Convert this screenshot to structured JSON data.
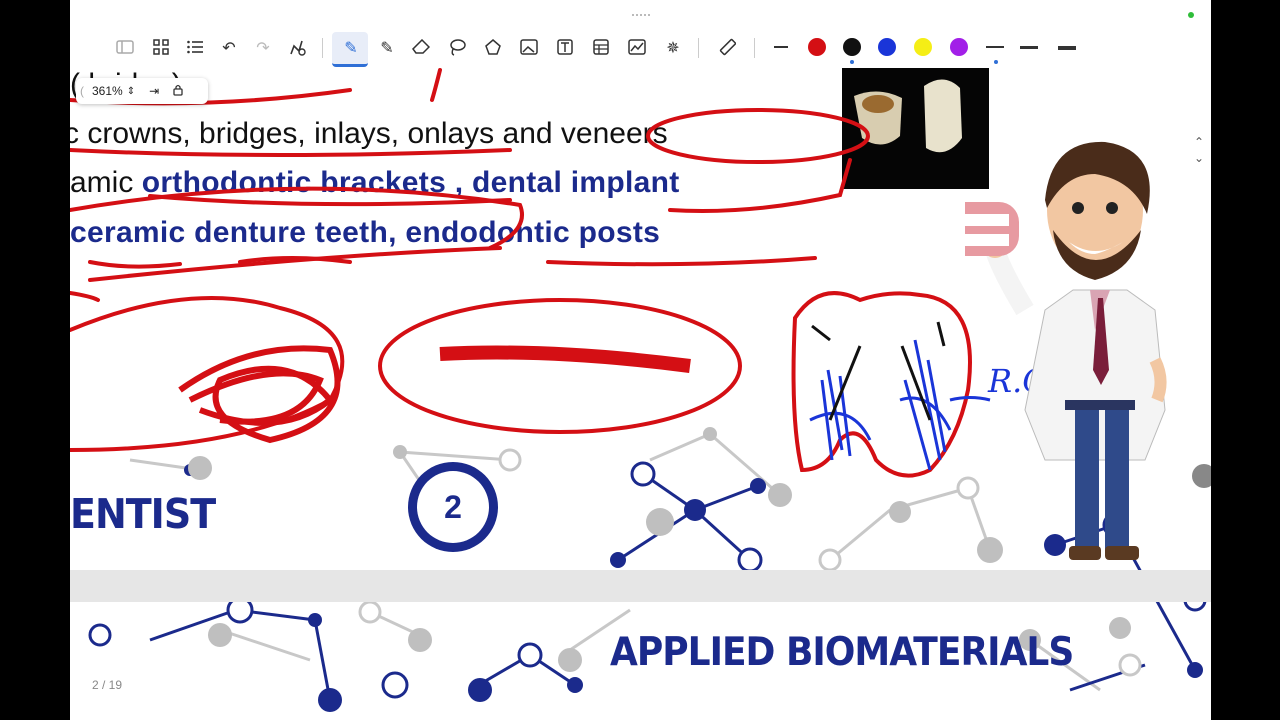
{
  "toolbar": {
    "tools": [
      "sidebar-toggle-icon",
      "grid-icon",
      "list-icon",
      "undo-icon",
      "redo-icon",
      "gesture-icon",
      "pen-icon",
      "highlighter-icon",
      "eraser-icon",
      "lasso-icon",
      "shapes-icon",
      "image-icon",
      "text-icon",
      "table-icon",
      "chart-icon",
      "laser-icon",
      "ruler-icon"
    ],
    "colors": [
      "#d40f14",
      "#111111",
      "#1a35d8",
      "#f5ee16",
      "#a21fe8"
    ],
    "strokes": [
      "thin",
      "medium",
      "thick"
    ]
  },
  "zoom": {
    "level": "361%"
  },
  "slide": {
    "line0": "(  bridge)",
    "line1_prefix": "c  crowns, bridges, inlays, onlays and veneers",
    "line2_a": "amic ",
    "line2_b": "orthodontic brackets , dental implant",
    "line3": "ceramic denture teeth, endodontic posts",
    "badge_number": "2",
    "left_heading": "ENTIST",
    "bottom_heading": "APPLIED BIOMATERIALS",
    "annotation": "R.C"
  },
  "pager": {
    "text": "2 / 19"
  }
}
